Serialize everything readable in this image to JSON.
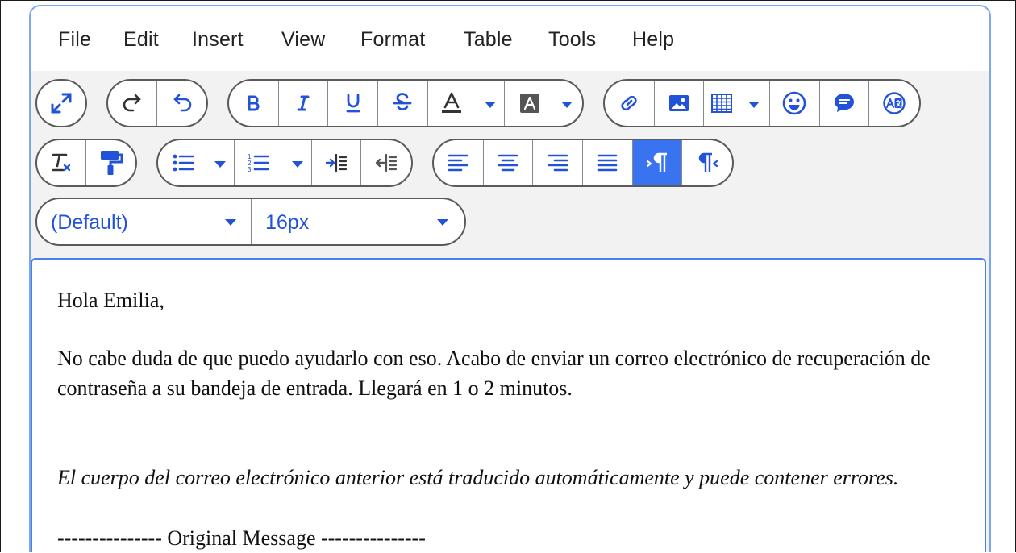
{
  "menu": [
    "File",
    "Edit",
    "Insert",
    "View",
    "Format",
    "Table",
    "Tools",
    "Help"
  ],
  "toolbar": {
    "font_family": "(Default)",
    "font_size": "16px"
  },
  "icons": {
    "fullscreen": "fullscreen-icon",
    "redo": "redo-icon",
    "undo": "undo-icon",
    "bold": "bold-icon",
    "italic": "italic-icon",
    "underline": "underline-icon",
    "strikethrough": "strikethrough-icon",
    "font_color": "font-color-icon",
    "background_color": "background-color-icon",
    "link": "link-icon",
    "image": "image-icon",
    "table": "table-icon",
    "emoji": "emoji-icon",
    "comment": "comment-icon",
    "translate": "translate-icon",
    "clear_format": "clear-format-icon",
    "format_painter": "format-painter-icon",
    "bullet_list": "bullet-list-icon",
    "numbered_list": "numbered-list-icon",
    "indent": "indent-icon",
    "outdent": "outdent-icon",
    "align_left": "align-left-icon",
    "align_center": "align-center-icon",
    "align_right": "align-right-icon",
    "align_justify": "align-justify-icon",
    "ltr": "ltr-icon",
    "rtl": "rtl-icon"
  },
  "colors": {
    "accent": "#3a73ef",
    "icon": "#2252d8",
    "border": "#5a5a5a"
  },
  "document": {
    "greeting": "Hola Emilia,",
    "body": "No cabe duda de que puedo ayudarlo con eso. Acabo de enviar un correo electrónico de recuperación de contraseña a su bandeja de entrada. Llegará en 1 o 2 minutos.",
    "disclaimer": "El cuerpo del correo electrónico anterior está traducido automáticamente y puede contener errores.",
    "separator": "--------------- Original Message ---------------"
  }
}
